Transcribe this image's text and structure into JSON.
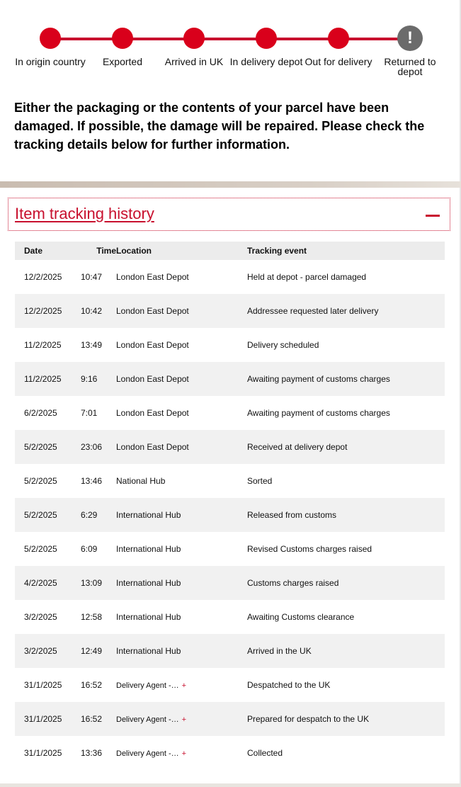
{
  "tracker": {
    "steps": [
      {
        "label": "In origin country",
        "status": "complete"
      },
      {
        "label": "Exported",
        "status": "complete"
      },
      {
        "label": "Arrived in UK",
        "status": "complete"
      },
      {
        "label": "In delivery depot",
        "status": "complete"
      },
      {
        "label": "Out for delivery",
        "status": "complete"
      },
      {
        "label": "Returned to depot",
        "status": "alert",
        "icon": "exclamation-icon",
        "symbol": "!"
      }
    ],
    "colors": {
      "complete": "#d9001b",
      "alert": "#6b6b6b",
      "line": "#c8102e"
    }
  },
  "message": "Either the packaging or the contents of your parcel have been damaged. If possible, the damage will be repaired. Please check the tracking details below for further information.",
  "history": {
    "title": "Item tracking history",
    "collapse_icon": "minus-icon",
    "columns": [
      "Date",
      "Time",
      "Location",
      "Tracking event"
    ],
    "rows": [
      {
        "date": "12/2/2025",
        "time": "10:47",
        "location": "London East Depot",
        "event": "Held at depot - parcel damaged"
      },
      {
        "date": "12/2/2025",
        "time": "10:42",
        "location": "London East Depot",
        "event": "Addressee requested later delivery"
      },
      {
        "date": "11/2/2025",
        "time": "13:49",
        "location": "London East Depot",
        "event": "Delivery scheduled"
      },
      {
        "date": "11/2/2025",
        "time": "9:16",
        "location": "London East Depot",
        "event": "Awaiting payment of customs charges"
      },
      {
        "date": "6/2/2025",
        "time": "7:01",
        "location": "London East Depot",
        "event": "Awaiting payment of customs charges"
      },
      {
        "date": "5/2/2025",
        "time": "23:06",
        "location": "London East Depot",
        "event": "Received at delivery depot"
      },
      {
        "date": "5/2/2025",
        "time": "13:46",
        "location": "National Hub",
        "event": "Sorted"
      },
      {
        "date": "5/2/2025",
        "time": "6:29",
        "location": "International Hub",
        "event": "Released from customs"
      },
      {
        "date": "5/2/2025",
        "time": "6:09",
        "location": "International Hub",
        "event": "Revised Customs charges raised"
      },
      {
        "date": "4/2/2025",
        "time": "13:09",
        "location": "International Hub",
        "event": "Customs charges raised"
      },
      {
        "date": "3/2/2025",
        "time": "12:58",
        "location": "International Hub",
        "event": "Awaiting Customs clearance"
      },
      {
        "date": "3/2/2025",
        "time": "12:49",
        "location": "International Hub",
        "event": "Arrived in the UK"
      },
      {
        "date": "31/1/2025",
        "time": "16:52",
        "location": "Delivery Agent -…",
        "expandable": "+",
        "event": "Despatched to the UK"
      },
      {
        "date": "31/1/2025",
        "time": "16:52",
        "location": "Delivery Agent -…",
        "expandable": "+",
        "event": "Prepared for despatch to the UK"
      },
      {
        "date": "31/1/2025",
        "time": "13:36",
        "location": "Delivery Agent -…",
        "expandable": "+",
        "event": "Collected"
      }
    ]
  }
}
